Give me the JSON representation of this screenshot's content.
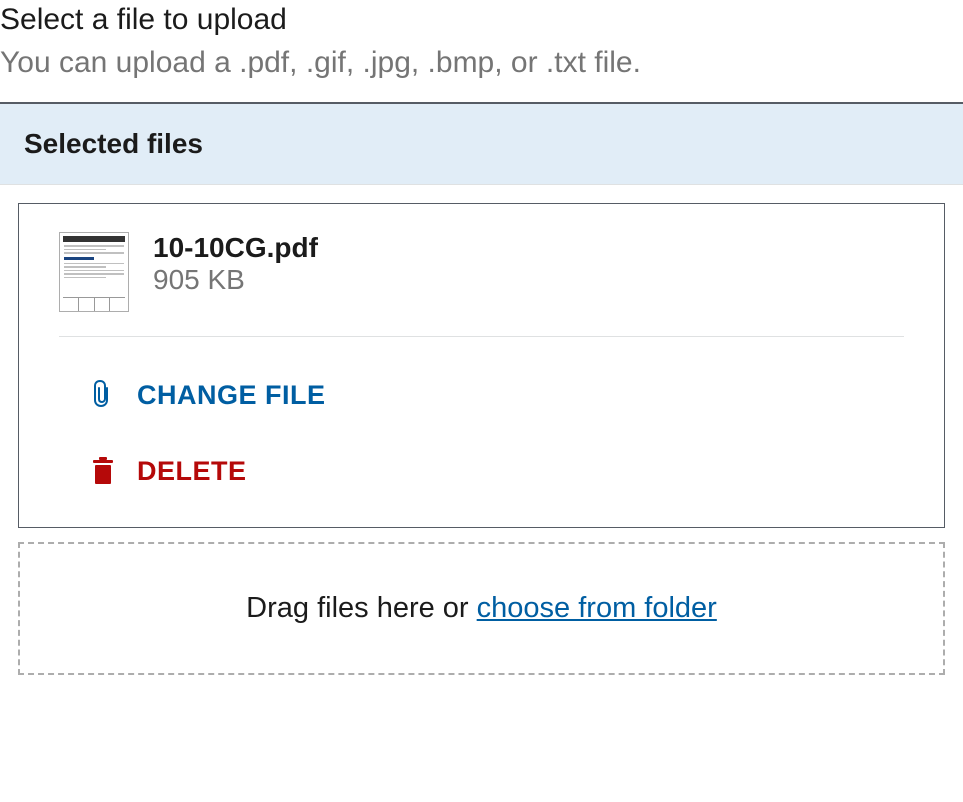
{
  "header": {
    "title": "Select a file to upload",
    "subtitle": "You can upload a .pdf, .gif, .jpg, .bmp, or .txt file."
  },
  "panel": {
    "heading": "Selected files"
  },
  "file": {
    "name": "10-10CG.pdf",
    "size": "905 KB"
  },
  "actions": {
    "change": "CHANGE FILE",
    "delete": "DELETE"
  },
  "dropzone": {
    "prefix": "Drag files here or ",
    "link": "choose from folder"
  }
}
